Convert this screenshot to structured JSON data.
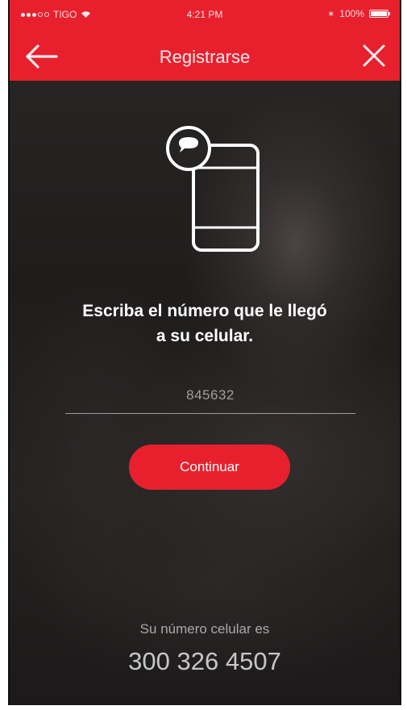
{
  "statusbar": {
    "carrier": "TIGO",
    "time": "4:21 PM",
    "battery": "100%"
  },
  "navbar": {
    "title": "Registrarse",
    "back_icon": "arrow-left-icon",
    "close_icon": "close-icon"
  },
  "illustration": {
    "icon": "phone-message-icon"
  },
  "instruction": {
    "line1": "Escriba el número que le llegó",
    "line2": "a su celular."
  },
  "code_input": {
    "value": "845632"
  },
  "continue_button": {
    "label": "Continuar"
  },
  "phone_info": {
    "label": "Su número celular es",
    "number": "300 326 4507"
  },
  "colors": {
    "brand_red": "#e8202e",
    "background": "#1f1d1d"
  }
}
